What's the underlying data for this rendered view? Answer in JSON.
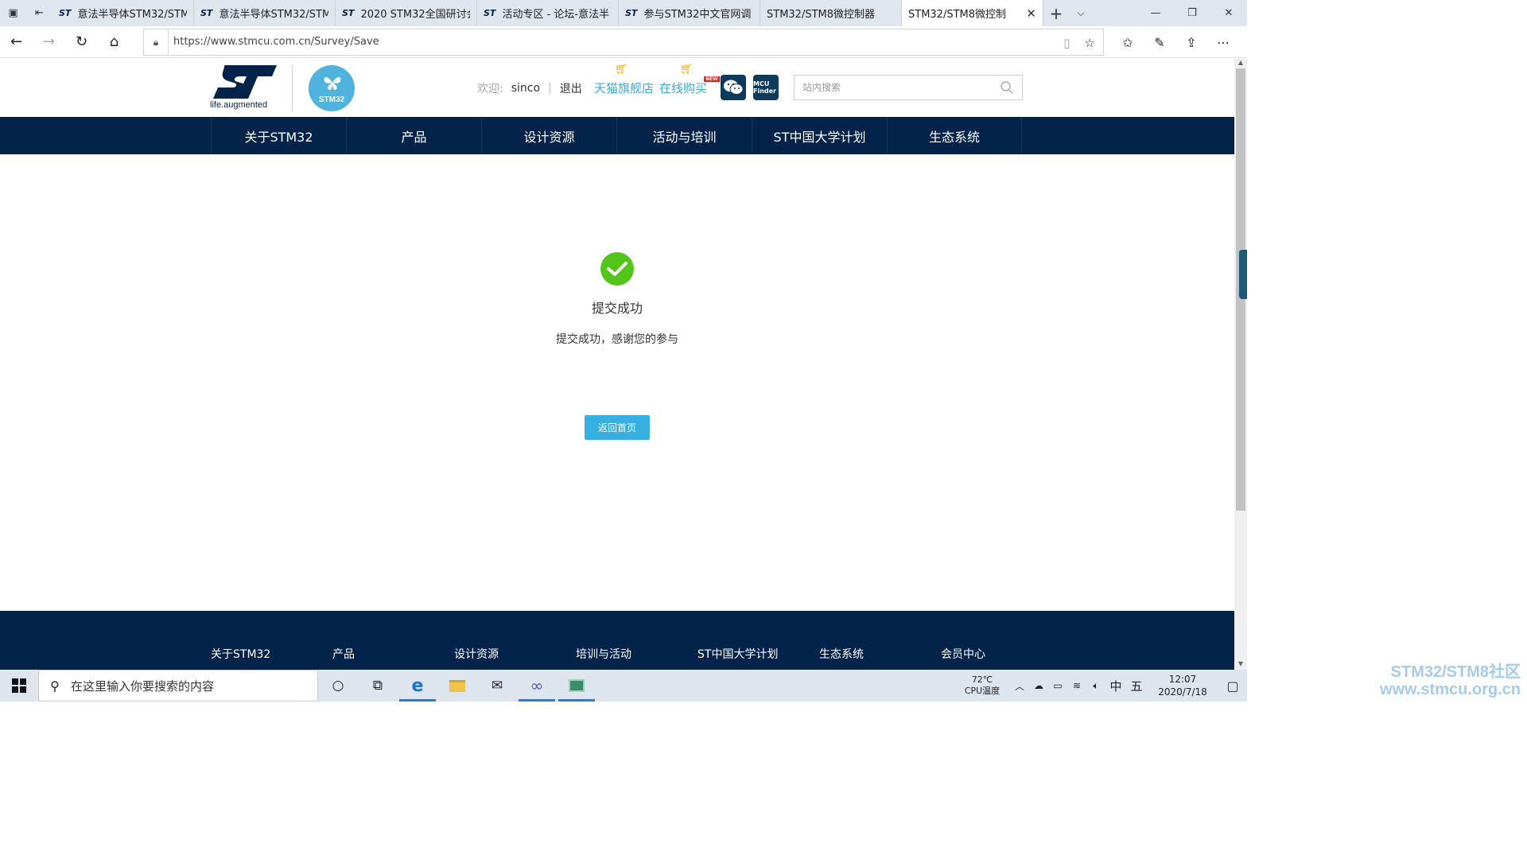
{
  "browser": {
    "tabs": [
      {
        "title": "意法半导体STM32/STM",
        "favicon": "st-logo-icon"
      },
      {
        "title": "意法半导体STM32/STM",
        "favicon": "st-logo-icon"
      },
      {
        "title": "2020 STM32全国研讨会",
        "favicon": "st-logo-icon"
      },
      {
        "title": "活动专区 - 论坛-意法半",
        "favicon": "st-logo-icon"
      },
      {
        "title": "参与STM32中文官网调",
        "favicon": "st-logo-icon"
      },
      {
        "title": "STM32/STM8微控制器",
        "favicon": "page-icon"
      },
      {
        "title": "STM32/STM8微控制",
        "favicon": "page-icon",
        "active": true
      }
    ],
    "url": "https://www.stmcu.com.cn/Survey/Save"
  },
  "header": {
    "logo_tagline": "life.augmented",
    "stm32_badge": "STM32",
    "welcome": "欢迎:",
    "username": "sinco",
    "separator": "|",
    "logout": "退出",
    "tmall_link": "天猫旗舰店",
    "buy_link": "在线购买",
    "new_badge": "NEW",
    "mcu_finder_label": "MCU Finder",
    "search_placeholder": "站内搜索"
  },
  "nav": {
    "items": [
      "关于STM32",
      "产品",
      "设计资源",
      "活动与培训",
      "ST中国大学计划",
      "生态系统"
    ]
  },
  "result": {
    "title": "提交成功",
    "message": "提交成功，感谢您的参与",
    "button": "返回首页",
    "color": "#52c41a"
  },
  "footer": {
    "links": [
      "关于STM32",
      "产品",
      "设计资源",
      "培训与活动",
      "ST中国大学计划",
      "生态系统",
      "会员中心"
    ]
  },
  "taskbar": {
    "search_placeholder": "在这里输入你要搜索的内容",
    "temperature": "72℃",
    "temperature_label": "CPU温度",
    "ime_lang": "中",
    "ime_mode": "五",
    "time": "12:07",
    "date": "2020/7/18"
  },
  "watermark": {
    "line1": "STM32/STM8社区",
    "line2": "www.stmcu.org.cn"
  },
  "colors": {
    "nav_bg": "#03234b",
    "accent": "#35b0e0",
    "link": "#3fa9dd"
  }
}
